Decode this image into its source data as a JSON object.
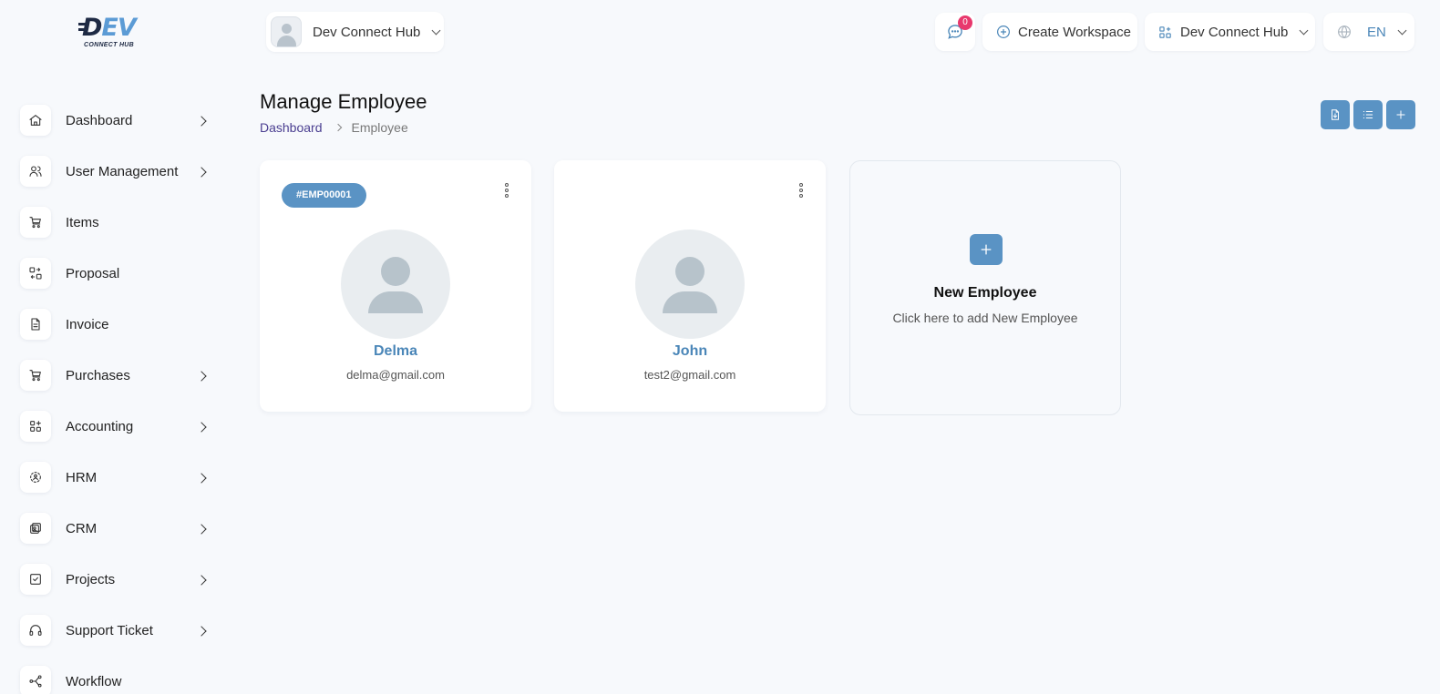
{
  "brand": {
    "logo_main": "DEV",
    "logo_sub": "CONNECT HUB"
  },
  "sidebar": {
    "items": [
      {
        "label": "Dashboard",
        "icon": "home-icon",
        "has_submenu": true
      },
      {
        "label": "User Management",
        "icon": "users-icon",
        "has_submenu": true
      },
      {
        "label": "Items",
        "icon": "cart-icon",
        "has_submenu": false
      },
      {
        "label": "Proposal",
        "icon": "swap-icon",
        "has_submenu": false
      },
      {
        "label": "Invoice",
        "icon": "file-icon",
        "has_submenu": false
      },
      {
        "label": "Purchases",
        "icon": "cart-icon",
        "has_submenu": true
      },
      {
        "label": "Accounting",
        "icon": "apps-icon",
        "has_submenu": true
      },
      {
        "label": "HRM",
        "icon": "hrm-icon",
        "has_submenu": true
      },
      {
        "label": "CRM",
        "icon": "crm-icon",
        "has_submenu": true
      },
      {
        "label": "Projects",
        "icon": "check-square-icon",
        "has_submenu": true
      },
      {
        "label": "Support Ticket",
        "icon": "headphones-icon",
        "has_submenu": true
      },
      {
        "label": "Workflow",
        "icon": "workflow-icon",
        "has_submenu": false
      }
    ]
  },
  "header": {
    "workspace_name": "Dev Connect Hub",
    "message_count": "0",
    "create_workspace_label": "Create Workspace",
    "current_workspace": "Dev Connect Hub",
    "language": "EN"
  },
  "page": {
    "title": "Manage Employee",
    "breadcrumb": [
      "Dashboard",
      "Employee"
    ],
    "tools": [
      "import-icon",
      "list-icon",
      "plus-icon"
    ]
  },
  "employees": [
    {
      "code": "#EMP00001",
      "name": "Delma",
      "email": "delma@gmail.com"
    },
    {
      "code": "",
      "name": "John",
      "email": "test2@gmail.com"
    }
  ],
  "new_employee": {
    "title": "New Employee",
    "subtitle": "Click here to add New Employee"
  },
  "colors": {
    "accent": "#5a93c4",
    "badge": "#e8386d",
    "breadcrumb_link": "#4b3f91",
    "background": "#f7f9fc"
  }
}
